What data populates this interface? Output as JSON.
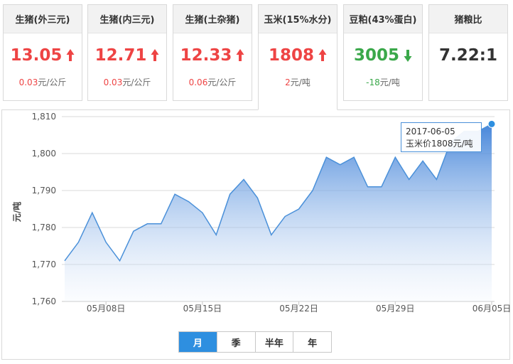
{
  "cards": [
    {
      "title": "生猪(外三元)",
      "price": "13.05",
      "change": "0.03",
      "unit": "元/公斤",
      "direction": "up"
    },
    {
      "title": "生猪(内三元)",
      "price": "12.71",
      "change": "0.03",
      "unit": "元/公斤",
      "direction": "up"
    },
    {
      "title": "生猪(土杂猪)",
      "price": "12.33",
      "change": "0.06",
      "unit": "元/公斤",
      "direction": "up"
    },
    {
      "title": "玉米(15%水分)",
      "price": "1808",
      "change": "2",
      "unit": "元/吨",
      "direction": "up"
    },
    {
      "title": "豆粕(43%蛋白)",
      "price": "3005",
      "change": "-18",
      "unit": "元/吨",
      "direction": "down"
    },
    {
      "title": "猪粮比",
      "price": "7.22:1",
      "change": "",
      "unit": "",
      "direction": "none"
    }
  ],
  "colors": {
    "up": "#ee4444",
    "down": "#3aa84a",
    "accent": "#2e8fe0",
    "line": "#4a90d9"
  },
  "tooltip": {
    "date": "2017-06-05",
    "label": "玉米价",
    "value": "1808",
    "unit": "元/吨"
  },
  "range_tabs": [
    {
      "label": "月",
      "active": true
    },
    {
      "label": "季",
      "active": false
    },
    {
      "label": "半年",
      "active": false
    },
    {
      "label": "年",
      "active": false
    }
  ],
  "chart_data": {
    "type": "area",
    "ylabel": "元/吨",
    "ylim": [
      1760,
      1810
    ],
    "yticks": [
      "1,760",
      "1,770",
      "1,780",
      "1,790",
      "1,800",
      "1,810"
    ],
    "xticks": [
      "05月08日",
      "05月15日",
      "05月22日",
      "05月29日",
      "06月05日"
    ],
    "x": [
      "05-05",
      "05-06",
      "05-07",
      "05-08",
      "05-09",
      "05-10",
      "05-11",
      "05-12",
      "05-13",
      "05-14",
      "05-15",
      "05-16",
      "05-17",
      "05-18",
      "05-19",
      "05-20",
      "05-21",
      "05-22",
      "05-23",
      "05-24",
      "05-25",
      "05-26",
      "05-27",
      "05-28",
      "05-29",
      "05-30",
      "05-31",
      "06-01",
      "06-02",
      "06-03",
      "06-04",
      "06-05"
    ],
    "series": [
      {
        "values": [
          1771,
          1776,
          1784,
          1776,
          1771,
          1779,
          1781,
          1781,
          1789,
          1787,
          1784,
          1778,
          1789,
          1793,
          1788,
          1778,
          1783,
          1785,
          1790,
          1799,
          1797,
          1799,
          1791,
          1791,
          1799,
          1793,
          1798,
          1793,
          1803,
          1806,
          1806,
          1808
        ]
      }
    ],
    "grid": true,
    "legend": "none"
  }
}
